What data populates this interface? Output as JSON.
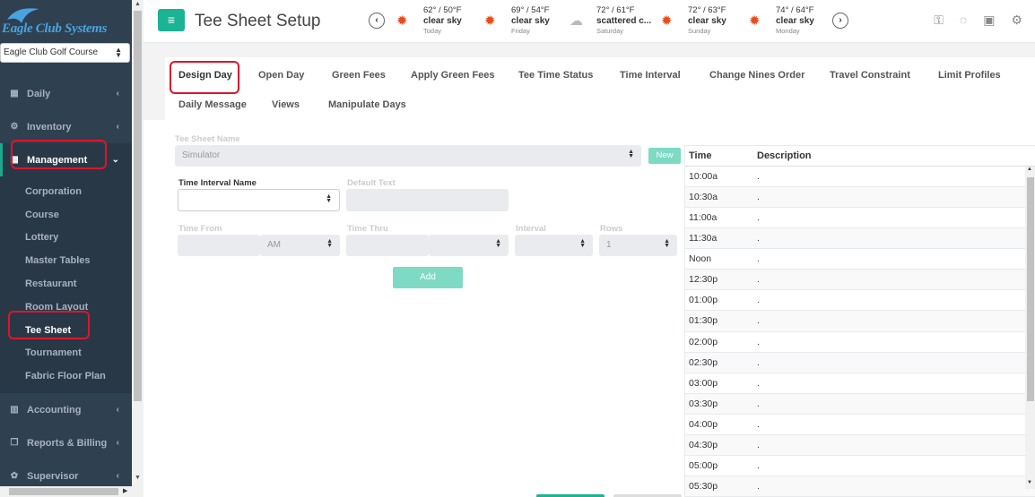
{
  "app": {
    "logo_text": "Eagle Club Systems",
    "course": "Eagle Club Golf Course"
  },
  "sidebar": {
    "items": [
      {
        "label": "Daily",
        "icon": "calendar-icon"
      },
      {
        "label": "Inventory",
        "icon": "cogs-icon"
      },
      {
        "label": "Management",
        "icon": "grid-icon"
      },
      {
        "label": "Accounting",
        "icon": "bar-chart-icon"
      },
      {
        "label": "Reports & Billing",
        "icon": "copy-icon"
      },
      {
        "label": "Supervisor",
        "icon": "gear-icon"
      }
    ],
    "management_sub": [
      "Corporation",
      "Course",
      "Lottery",
      "Master Tables",
      "Restaurant",
      "Room Layout",
      "Tee Sheet",
      "Tournament",
      "Fabric Floor Plan"
    ]
  },
  "header": {
    "title": "Tee Sheet Setup",
    "weather": [
      {
        "temp": "62° / 50°F",
        "cond": "clear sky",
        "day": "Today",
        "icon": "sun-icon"
      },
      {
        "temp": "69° / 54°F",
        "cond": "clear sky",
        "day": "Friday",
        "icon": "sun-icon"
      },
      {
        "temp": "72° / 61°F",
        "cond": "scattered c...",
        "day": "Saturday",
        "icon": "cloud-icon"
      },
      {
        "temp": "72° / 63°F",
        "cond": "clear sky",
        "day": "Sunday",
        "icon": "sun-icon"
      },
      {
        "temp": "74° / 64°F",
        "cond": "clear sky",
        "day": "Monday",
        "icon": "sun-icon"
      }
    ]
  },
  "tabs": {
    "row1": [
      "Design Day",
      "Open Day",
      "Green Fees",
      "Apply Green Fees",
      "Tee Time Status",
      "Time Interval",
      "Change Nines Order",
      "Travel Constraint",
      "Limit Profiles"
    ],
    "row2": [
      "Daily Message",
      "Views",
      "Manipulate Days"
    ]
  },
  "form": {
    "tee_sheet_name_label": "Tee Sheet Name",
    "tee_sheet_name_value": "Simulator",
    "new_label": "New",
    "time_interval_name_label": "Time Interval Name",
    "default_text_label": "Default Text",
    "time_from_label": "Time From",
    "ampm_value": "AM",
    "time_thru_label": "Time Thru",
    "interval_label": "Interval",
    "rows_label": "Rows",
    "rows_value": "1",
    "add_label": "Add"
  },
  "table": {
    "headers": [
      "Time",
      "Description"
    ],
    "rows": [
      [
        "10:00a",
        "."
      ],
      [
        "10:30a",
        "."
      ],
      [
        "11:00a",
        "."
      ],
      [
        "11:30a",
        "."
      ],
      [
        "Noon",
        "."
      ],
      [
        "12:30p",
        "."
      ],
      [
        "01:00p",
        "."
      ],
      [
        "01:30p",
        "."
      ],
      [
        "02:00p",
        "."
      ],
      [
        "02:30p",
        "."
      ],
      [
        "03:00p",
        "."
      ],
      [
        "03:30p",
        "."
      ],
      [
        "04:00p",
        "."
      ],
      [
        "04:30p",
        "."
      ],
      [
        "05:00p",
        "."
      ],
      [
        "05:30p",
        "."
      ]
    ]
  },
  "colors": {
    "sidebar": "#2f4050",
    "accent": "#1ab394",
    "highlight": "#e0142c"
  }
}
